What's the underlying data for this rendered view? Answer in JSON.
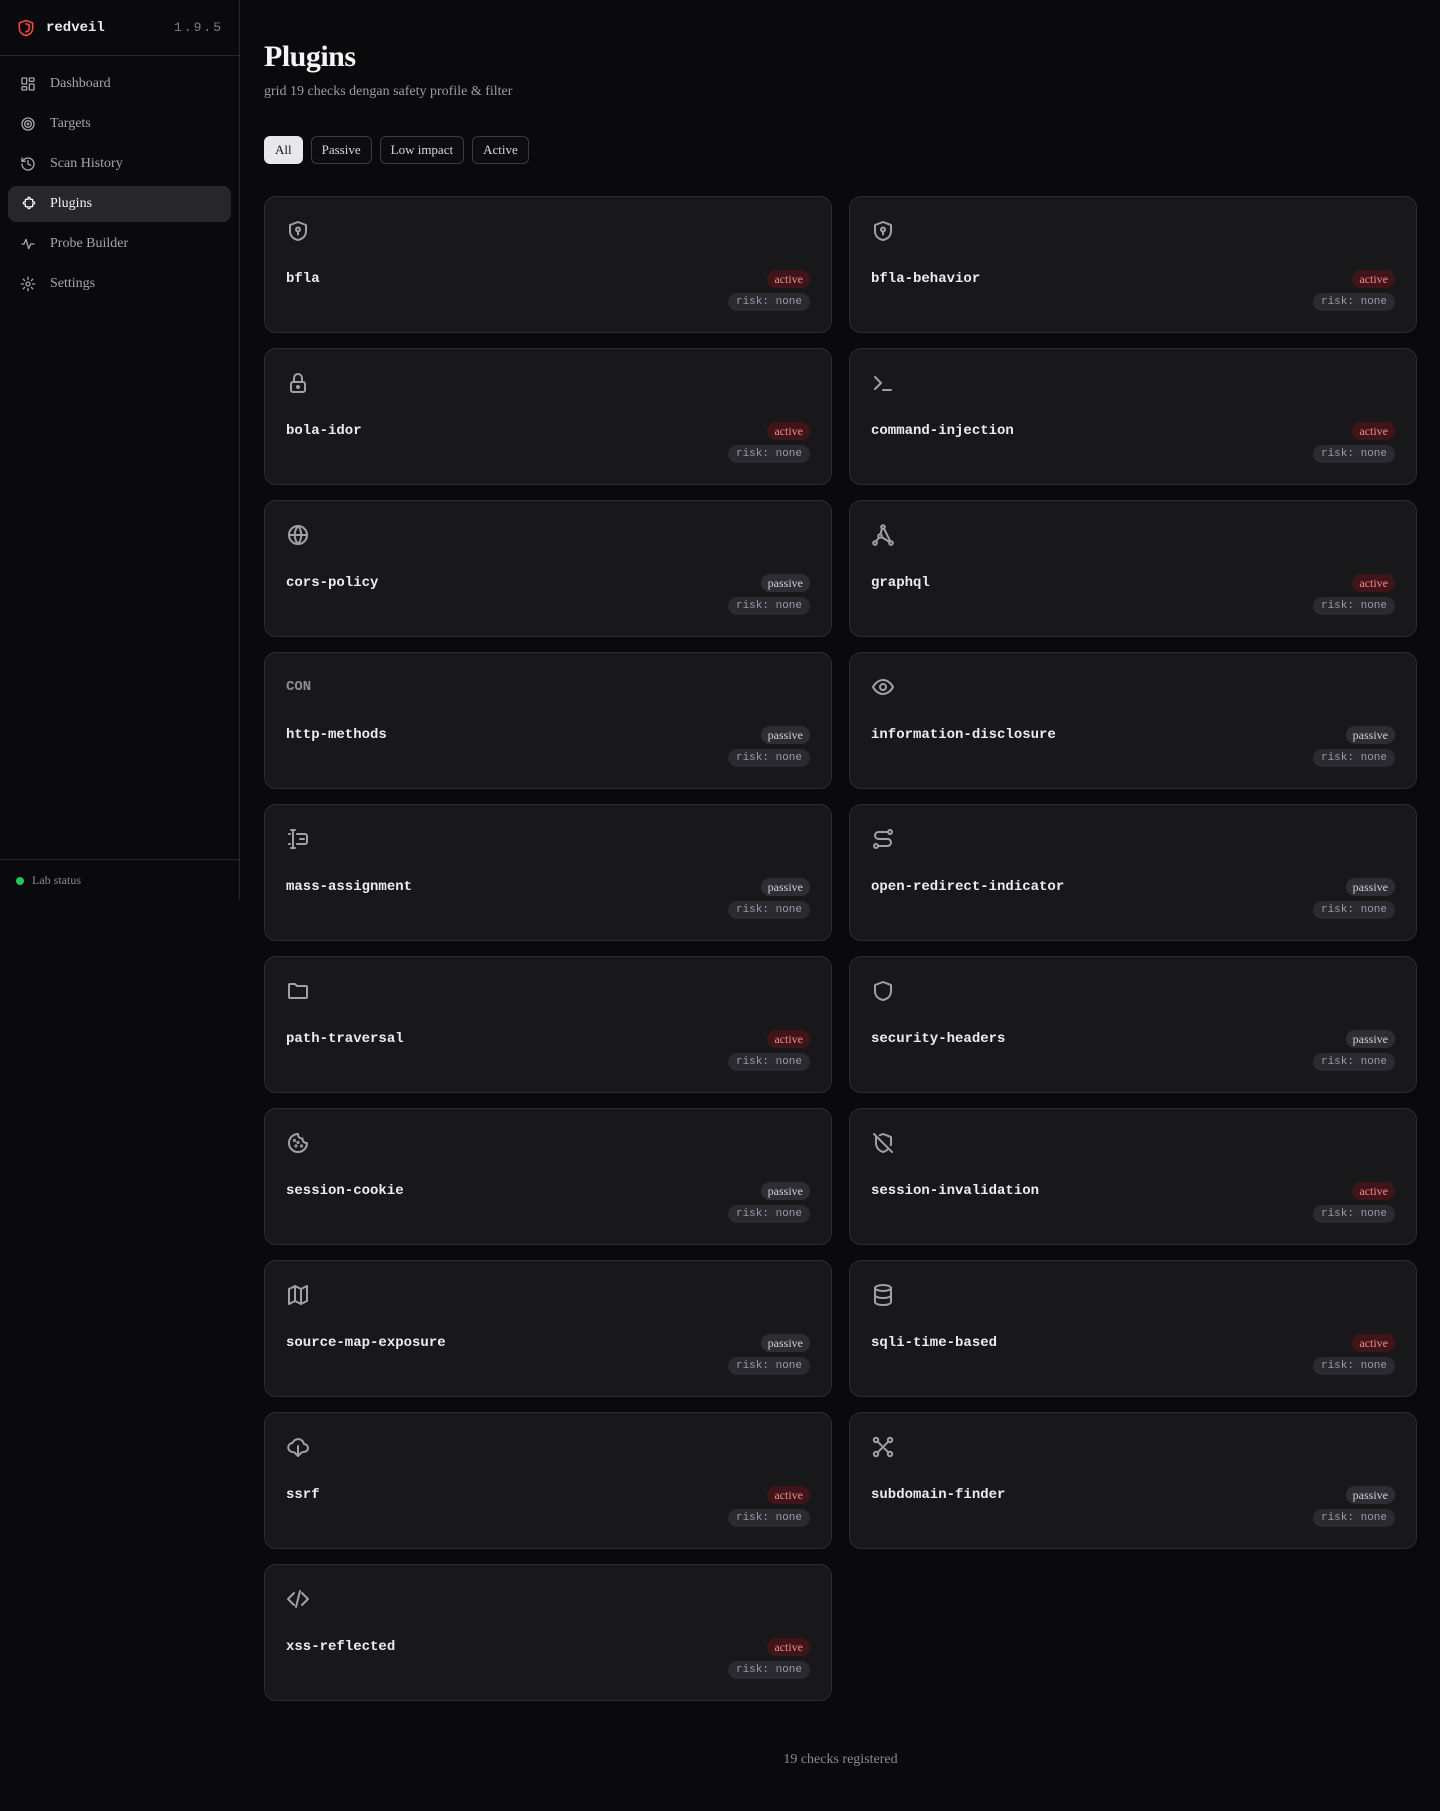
{
  "brand": {
    "name": "redveil",
    "version": "1.9.5"
  },
  "nav": [
    {
      "label": "Dashboard",
      "icon": "dashboard-icon",
      "active": false
    },
    {
      "label": "Targets",
      "icon": "target-icon",
      "active": false
    },
    {
      "label": "Scan History",
      "icon": "history-icon",
      "active": false
    },
    {
      "label": "Plugins",
      "icon": "puzzle-icon",
      "active": true
    },
    {
      "label": "Probe Builder",
      "icon": "pulse-icon",
      "active": false
    },
    {
      "label": "Settings",
      "icon": "gear-icon",
      "active": false
    }
  ],
  "sidebar_footer": {
    "status_label": "Lab status",
    "status_color": "#22c55e"
  },
  "header": {
    "title": "Plugins",
    "subtitle": "grid 19 checks dengan safety profile & filter"
  },
  "filters": [
    {
      "label": "All",
      "selected": true
    },
    {
      "label": "Passive",
      "selected": false
    },
    {
      "label": "Low impact",
      "selected": false
    },
    {
      "label": "Active",
      "selected": false
    }
  ],
  "plugins": [
    {
      "name": "bfla",
      "icon": "shield-key-icon",
      "mode": "active",
      "risk": "risk: none"
    },
    {
      "name": "bfla-behavior",
      "icon": "shield-key-icon",
      "mode": "active",
      "risk": "risk: none"
    },
    {
      "name": "bola-idor",
      "icon": "lock-icon",
      "mode": "active",
      "risk": "risk: none"
    },
    {
      "name": "command-injection",
      "icon": "terminal-icon",
      "mode": "active",
      "risk": "risk: none"
    },
    {
      "name": "cors-policy",
      "icon": "globe-icon",
      "mode": "passive",
      "risk": "risk: none"
    },
    {
      "name": "graphql",
      "icon": "graph-nodes-icon",
      "mode": "active",
      "risk": "risk: none"
    },
    {
      "name": "http-methods",
      "icon": "con-text-icon",
      "icon_text": "CON",
      "mode": "passive",
      "risk": "risk: none"
    },
    {
      "name": "information-disclosure",
      "icon": "eye-icon",
      "mode": "passive",
      "risk": "risk: none"
    },
    {
      "name": "mass-assignment",
      "icon": "text-cursor-input-icon",
      "mode": "passive",
      "risk": "risk: none"
    },
    {
      "name": "open-redirect-indicator",
      "icon": "route-icon",
      "mode": "passive",
      "risk": "risk: none"
    },
    {
      "name": "path-traversal",
      "icon": "folder-icon",
      "mode": "active",
      "risk": "risk: none"
    },
    {
      "name": "security-headers",
      "icon": "shield-icon",
      "mode": "passive",
      "risk": "risk: none"
    },
    {
      "name": "session-cookie",
      "icon": "cookie-icon",
      "mode": "passive",
      "risk": "risk: none"
    },
    {
      "name": "session-invalidation",
      "icon": "shield-off-icon",
      "mode": "active",
      "risk": "risk: none"
    },
    {
      "name": "source-map-exposure",
      "icon": "map-icon",
      "mode": "passive",
      "risk": "risk: none"
    },
    {
      "name": "sqli-time-based",
      "icon": "database-icon",
      "mode": "active",
      "risk": "risk: none"
    },
    {
      "name": "ssrf",
      "icon": "cloud-download-icon",
      "mode": "active",
      "risk": "risk: none"
    },
    {
      "name": "subdomain-finder",
      "icon": "network-icon",
      "mode": "passive",
      "risk": "risk: none"
    },
    {
      "name": "xss-reflected",
      "icon": "code-icon",
      "mode": "active",
      "risk": "risk: none"
    }
  ],
  "footer": {
    "count_text": "19 checks registered"
  },
  "colors": {
    "accent_active_bg": "#3f1519",
    "accent_active_text": "#f28b8b",
    "brand_red": "#ef4444"
  }
}
